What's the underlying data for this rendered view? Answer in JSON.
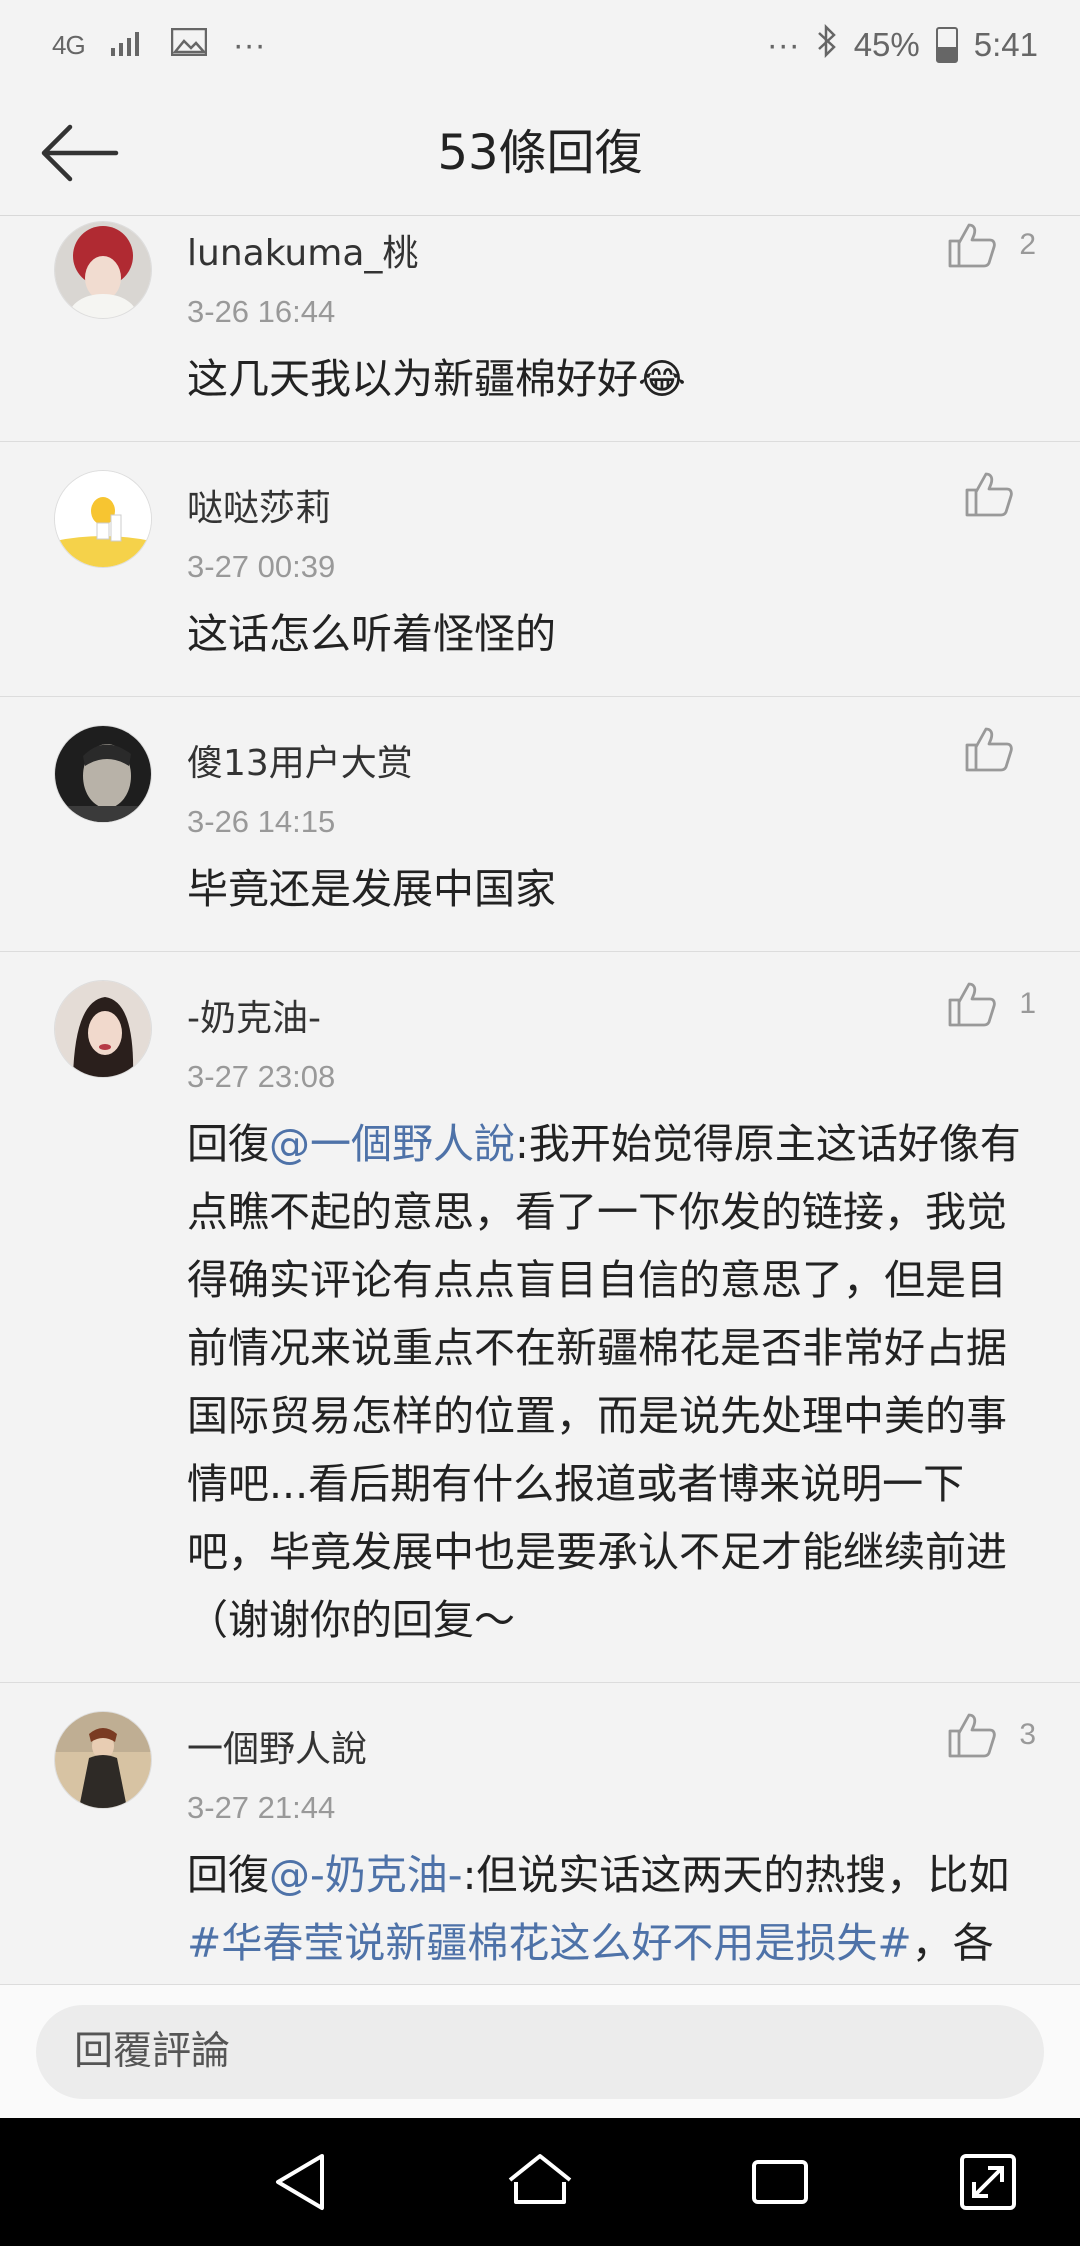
{
  "status_bar": {
    "network": "4G",
    "battery_text": "45%",
    "time": "5:41",
    "battery_level": 0.45
  },
  "header": {
    "title": "53條回復"
  },
  "comments": [
    {
      "username": "lunakuma_桃",
      "time": "3-26 16:44",
      "like_count": "2",
      "text_parts": [
        {
          "text": "这几天我以为新疆棉好好",
          "type": "text"
        }
      ],
      "emoji": "😂"
    },
    {
      "username": "哒哒莎莉",
      "time": "3-27 00:39",
      "like_count": "",
      "text_parts": [
        {
          "text": "这话怎么听着怪怪的",
          "type": "text"
        }
      ]
    },
    {
      "username": "傻13用户大赏",
      "time": "3-26 14:15",
      "like_count": "",
      "text_parts": [
        {
          "text": "毕竟还是发展中国家",
          "type": "text"
        }
      ]
    },
    {
      "username": "-奶克油-",
      "time": "3-27 23:08",
      "like_count": "1",
      "text_parts": [
        {
          "text": "回復",
          "type": "text"
        },
        {
          "text": "@一個野人說",
          "type": "mention"
        },
        {
          "text": ":我开始觉得原主这话好像有点瞧不起的意思，看了一下你发的链接，我觉得确实评论有点点盲目自信的意思了，但是目前情况来说重点不在新疆棉花是否非常好占据国际贸易怎样的位置，而是说先处理中美的事情吧...看后期有什么报道或者博来说明一下吧，毕竟发展中也是要承认不足才能继续前进（谢谢你的回复～",
          "type": "text"
        }
      ]
    },
    {
      "username": "一個野人說",
      "time": "3-27 21:44",
      "like_count": "3",
      "text_parts": [
        {
          "text": "回復",
          "type": "text"
        },
        {
          "text": "@-奶克油-",
          "type": "mention"
        },
        {
          "text": ":但说实话这两天的热搜，比如",
          "type": "text"
        },
        {
          "text": "#华春莹说新疆棉花这么好不用是损失#",
          "type": "hashtag"
        },
        {
          "text": "，各种棉花图片、视频，真的让我以为新疆棉花很",
          "type": "text"
        }
      ]
    }
  ],
  "reply_bar": {
    "placeholder": "回覆評論"
  },
  "colors": {
    "link": "#4e72a8",
    "background": "#f3f3f3",
    "nav_bar": "#000000"
  }
}
